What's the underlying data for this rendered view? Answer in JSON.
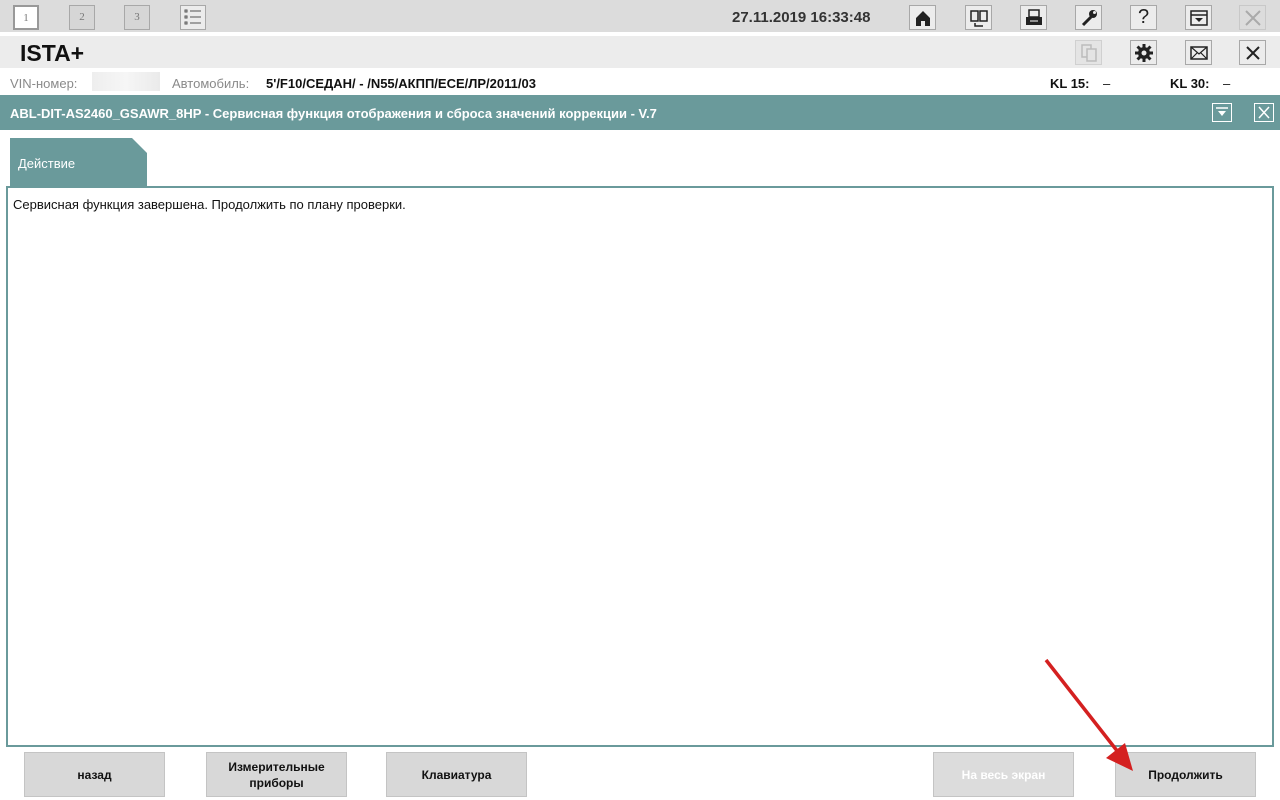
{
  "topbar": {
    "workspaces": [
      "1",
      "2",
      "3"
    ],
    "active_workspace": "1",
    "datetime": "27.11.2019 16:33:48",
    "tools": [
      "home-icon",
      "compare-icon",
      "print-icon",
      "wrench-icon",
      "help-icon",
      "minimize-window-icon",
      "close-icon"
    ]
  },
  "app": {
    "title": "ISTA+",
    "tools": [
      "copy-icon",
      "gear-icon",
      "mail-icon",
      "close-icon"
    ]
  },
  "vehicle": {
    "vin_label": "VIN-номер:",
    "car_label": "Автомобиль:",
    "car_value": "5'/F10/СЕДАН/ - /N55/АКПП/ECE/ЛР/2011/03",
    "kl15_label": "KL 15:",
    "kl15_value": "–",
    "kl30_label": "KL 30:",
    "kl30_value": "–"
  },
  "function": {
    "title": "ABL-DIT-AS2460_GSAWR_8HP - Сервисная функция отображения и сброса значений коррекции - V.7"
  },
  "tab": {
    "label": "Действие"
  },
  "content": {
    "message": "Сервисная функция завершена. Продолжить по плану проверки."
  },
  "buttons": {
    "back": "назад",
    "meters_line1": "Измерительные",
    "meters_line2": "приборы",
    "keyboard": "Клавиатура",
    "fullscreen": "На весь экран",
    "continue": "Продолжить"
  },
  "colors": {
    "accent": "#6a9a9b",
    "annotation_arrow": "#d42020"
  }
}
